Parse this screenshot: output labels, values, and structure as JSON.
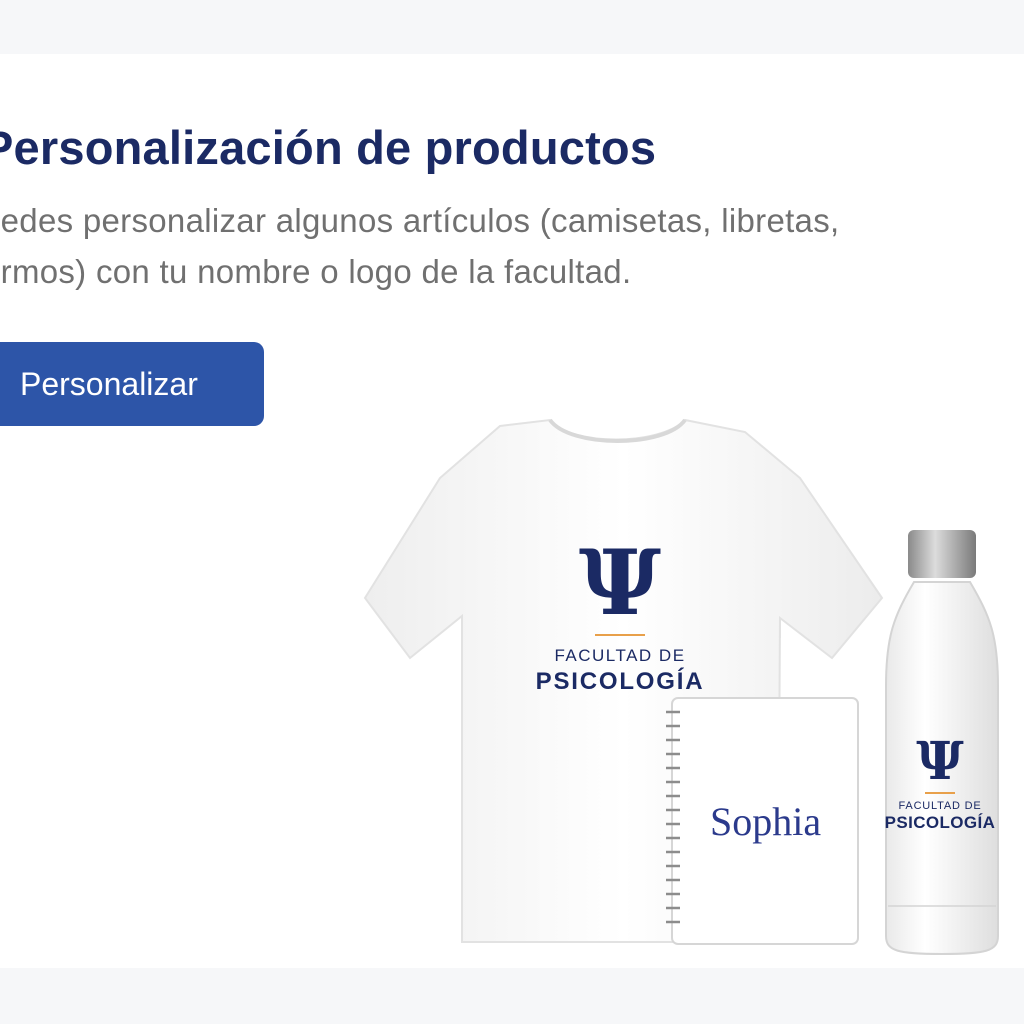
{
  "section": {
    "title": "Personalización de productos",
    "description": "uedes personalizar algunos artículos (camisetas, libretas, ermos) con tu nombre o logo de la facultad.",
    "button_label": "Personalizar"
  },
  "products": {
    "shirt": {
      "logo_symbol": "Ψ",
      "logo_line1": "FACULTAD DE",
      "logo_line2": "PSICOLOGÍA"
    },
    "notebook": {
      "name": "Sophia"
    },
    "bottle": {
      "logo_symbol": "Ψ",
      "logo_line1": "FACULTAD DE",
      "logo_line2": "PSICOLOGÍA"
    }
  },
  "colors": {
    "brand_navy": "#1b2a64",
    "button_blue": "#2d55a8",
    "accent_orange": "#e8a04a",
    "body_text": "#707070"
  },
  "icons": [
    "psi-logo-icon",
    "spiral-binding-icon"
  ]
}
